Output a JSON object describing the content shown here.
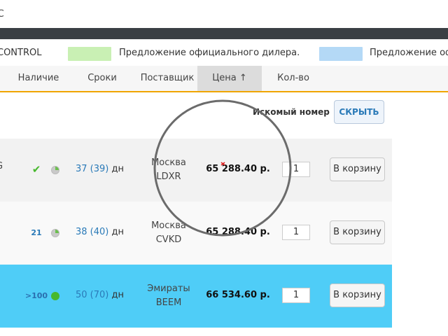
{
  "topbar": {
    "text": "C"
  },
  "legend": {
    "items": [
      {
        "label": "CONTROL",
        "color": ""
      },
      {
        "label": "Предложение официального дилера.",
        "color": "#c9f0b4"
      },
      {
        "label": "Предложение офи",
        "color": "#b4d9f6"
      }
    ]
  },
  "table_header": {
    "columns": [
      "Наличие",
      "Сроки",
      "Поставщик",
      "Цена ↑",
      "Кол-во"
    ],
    "sorted_column": "Цена ↑"
  },
  "search": {
    "label": "Искомый номер",
    "hide_button": "СКРЫТЬ"
  },
  "rows": [
    {
      "edge_text": [
        "-",
        "G"
      ],
      "stock": "✔",
      "availability": "partial",
      "term": "37 (39)",
      "days_suffix": "дн",
      "supplier_city": "Москва",
      "supplier_code": "LDXR",
      "price": "65 288.40 р.",
      "quantity": "1",
      "cart_button": "В корзину"
    },
    {
      "edge_text": [],
      "stock": "21",
      "availability": "partial",
      "term": "38 (40)",
      "days_suffix": "дн",
      "supplier_city": "Москва",
      "supplier_code": "CVKD",
      "price": "65 288.40 р.",
      "quantity": "1",
      "cart_button": "В корзину"
    },
    {
      "edge_text": [],
      "stock": ">100",
      "availability": "full",
      "term": "50 (70)",
      "days_suffix": "дн",
      "supplier_city": "Эмираты",
      "supplier_code": "BEEM",
      "price": "66 534.60 р.",
      "quantity": "1",
      "cart_button": "В корзину"
    }
  ],
  "colors": {
    "accent_orange": "#f0a500",
    "highlight_row": "#4fcdf7",
    "link_blue": "#2a7ab8",
    "check_green": "#47b82d"
  }
}
